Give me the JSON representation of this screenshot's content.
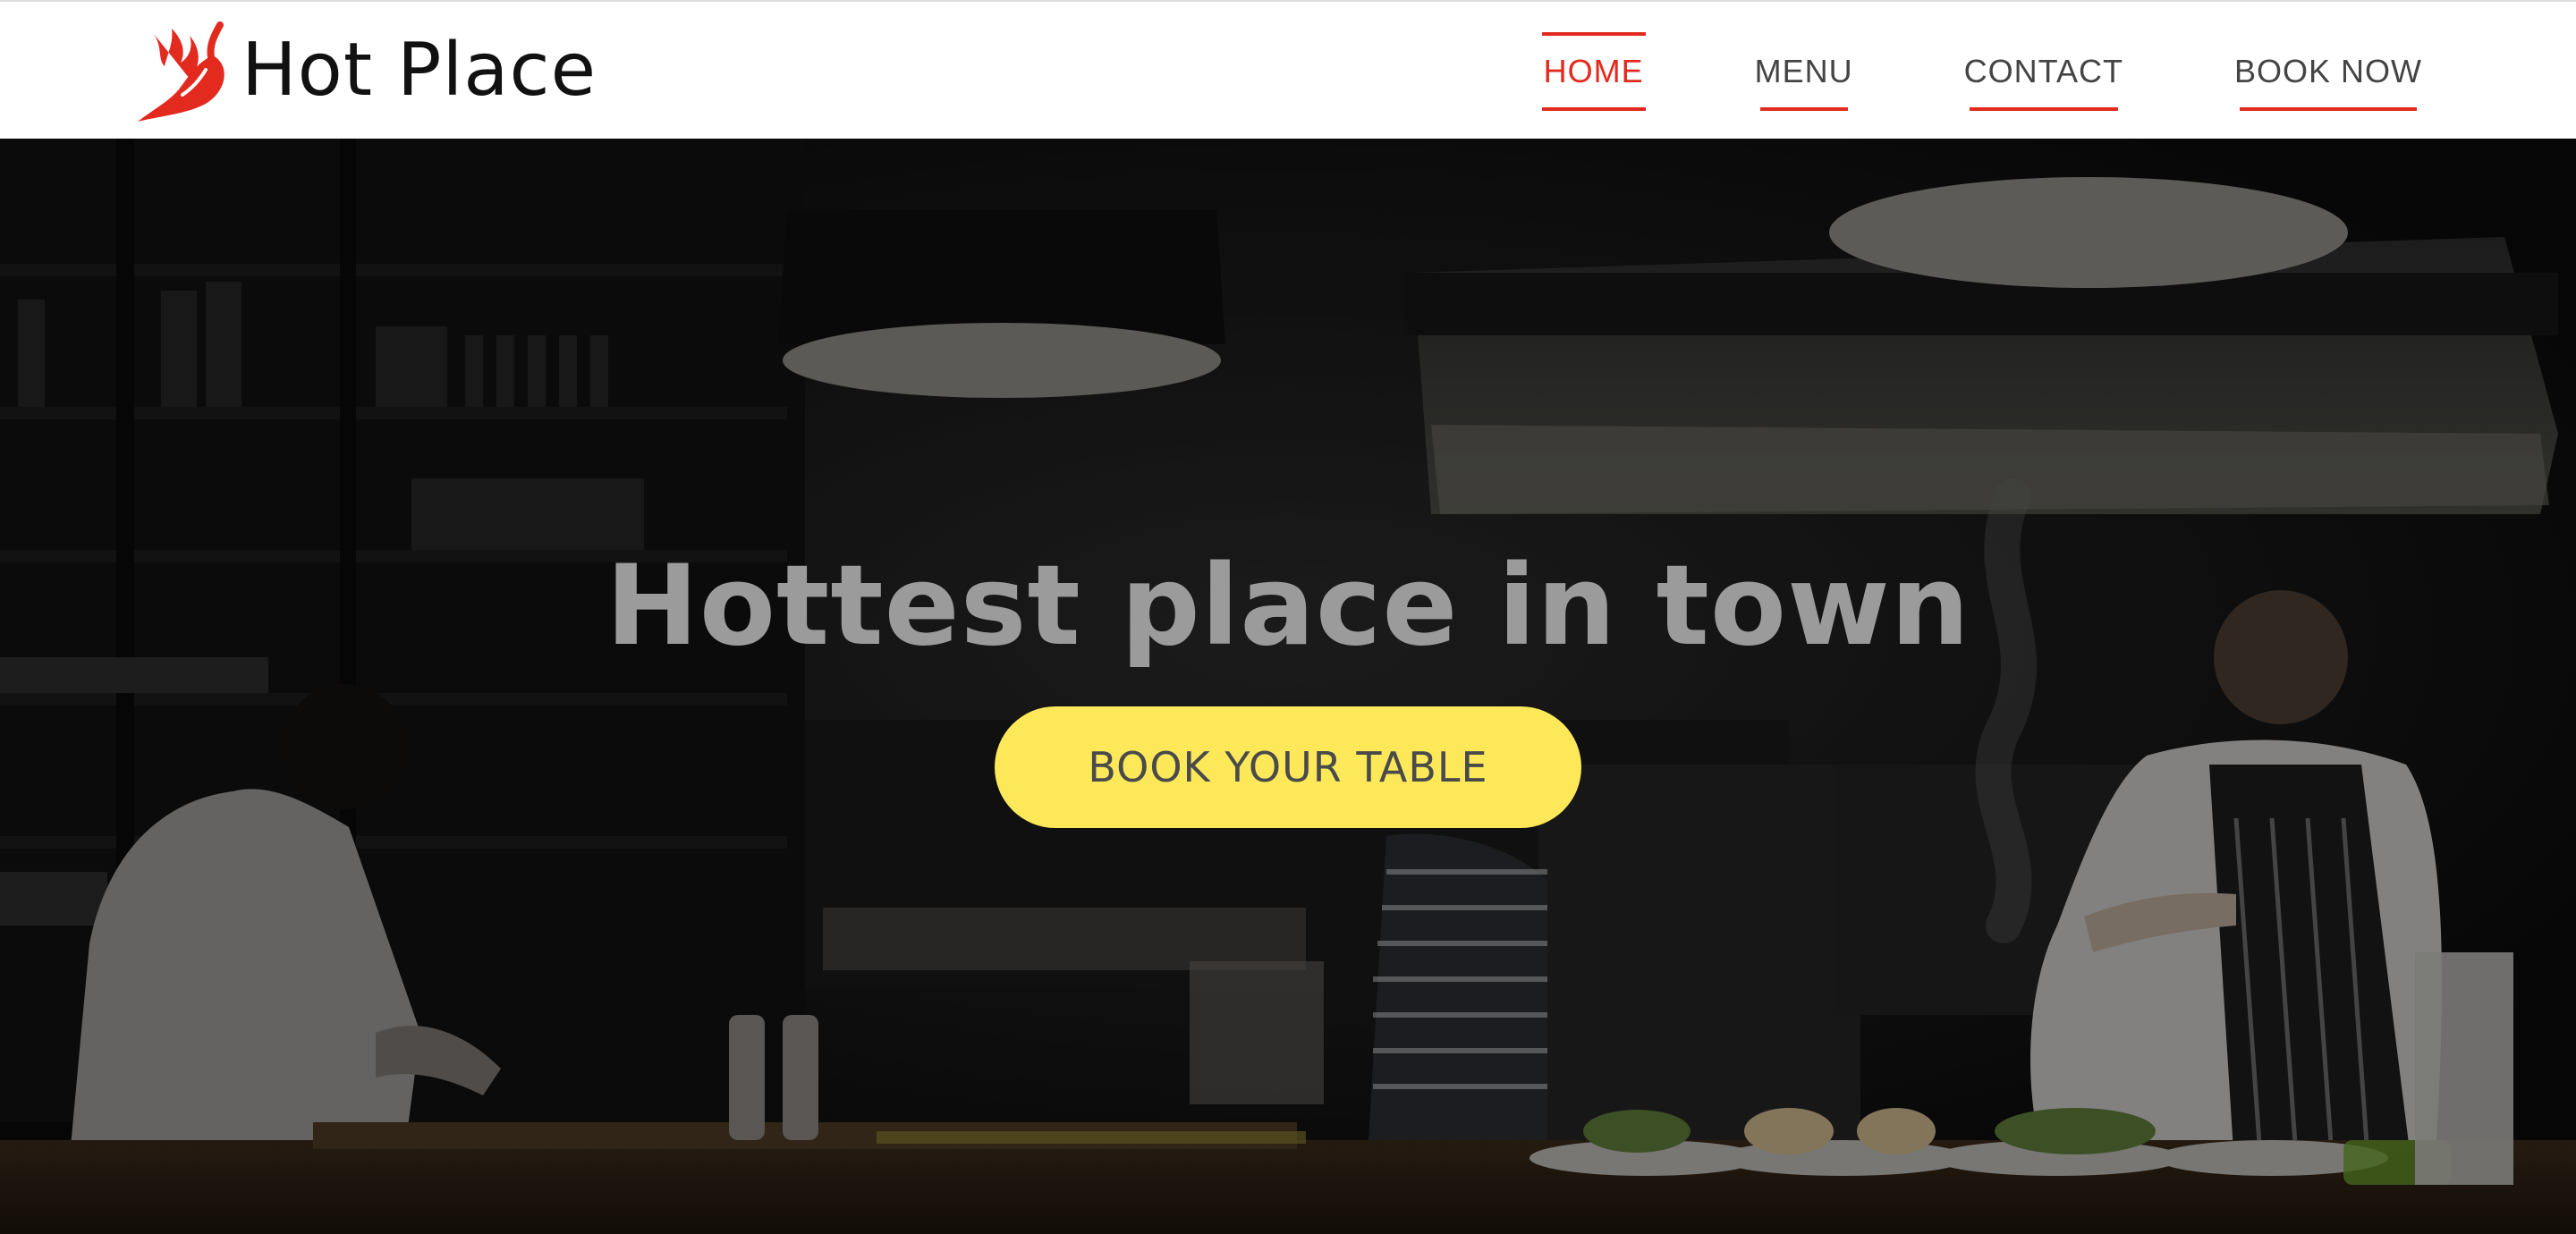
{
  "brand": {
    "name": "Hot Place",
    "logo_icon": "chili-pepper-flame-icon",
    "accent_color": "#e32a1f"
  },
  "nav": {
    "items": [
      {
        "label": "HOME",
        "active": true
      },
      {
        "label": "MENU",
        "active": false
      },
      {
        "label": "CONTACT",
        "active": false
      },
      {
        "label": "BOOK NOW",
        "active": false
      }
    ]
  },
  "hero": {
    "title": "Hottest place in town",
    "cta_label": "BOOK YOUR TABLE",
    "cta_color": "#fde85a",
    "background": "dark restaurant kitchen photo"
  }
}
